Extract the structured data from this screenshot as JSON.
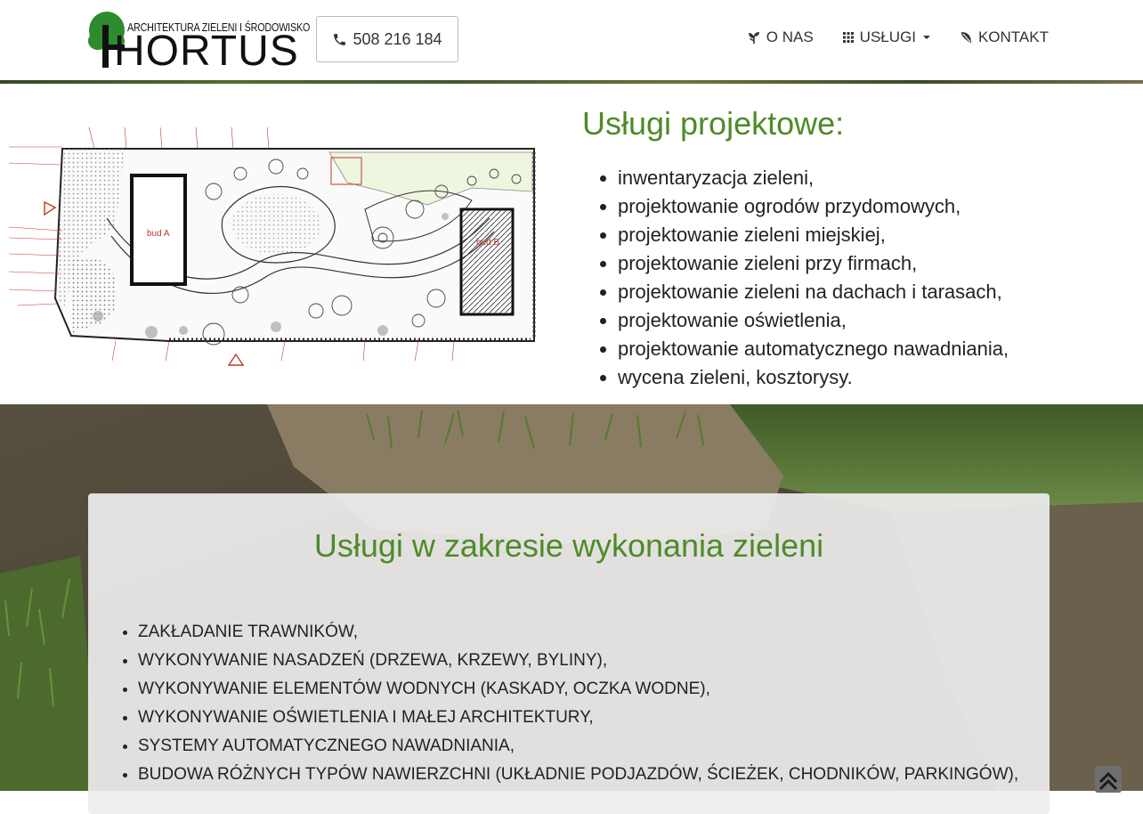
{
  "header": {
    "logo": {
      "tagline": "ARCHITEKTURA ZIELENI I ŚRODOWISKO",
      "wordmark": "HORTUS"
    },
    "phone": "508 216 184",
    "nav": [
      {
        "label": "O NAS",
        "icon": "plant-icon"
      },
      {
        "label": "USŁUGI",
        "icon": "grid-icon",
        "dropdown": true
      },
      {
        "label": "KONTAKT",
        "icon": "leaf-icon"
      }
    ]
  },
  "project_section": {
    "title": "Usługi projektowe:",
    "plan_labels": {
      "building_a": "bud A",
      "building_b": "bud B"
    },
    "items": [
      "inwentaryzacja zieleni,",
      "projektowanie ogrodów przydomowych,",
      "projektowanie zieleni miejskiej,",
      "projektowanie zieleni przy firmach,",
      "projektowanie zieleni na dachach i tarasach,",
      "projektowanie oświetlenia,",
      "projektowanie automatycznego nawadniania,",
      "wycena zieleni, kosztorysy."
    ]
  },
  "execution_section": {
    "title": "Usługi w zakresie wykonania zieleni",
    "items": [
      "ZAKŁADANIE TRAWNIKÓW,",
      "WYKONYWANIE NASADZEŃ (DRZEWA, KRZEWY, BYLINY),",
      "WYKONYWANIE ELEMENTÓW WODNYCH (KASKADY, OCZKA WODNE),",
      "WYKONYWANIE OŚWIETLENIA I MAŁEJ ARCHITEKTURY,",
      "SYSTEMY AUTOMATYCZNEGO NAWADNIANIA,",
      "BUDOWA RÓŻNYCH TYPÓW NAWIERZCHNI (UKŁADNIE PODJAZDÓW, ŚCIEŻEK, CHODNIKÓW, PARKINGÓW),"
    ]
  },
  "colors": {
    "accent_green": "#4f8a28",
    "logo_green": "#2e8b2e"
  }
}
